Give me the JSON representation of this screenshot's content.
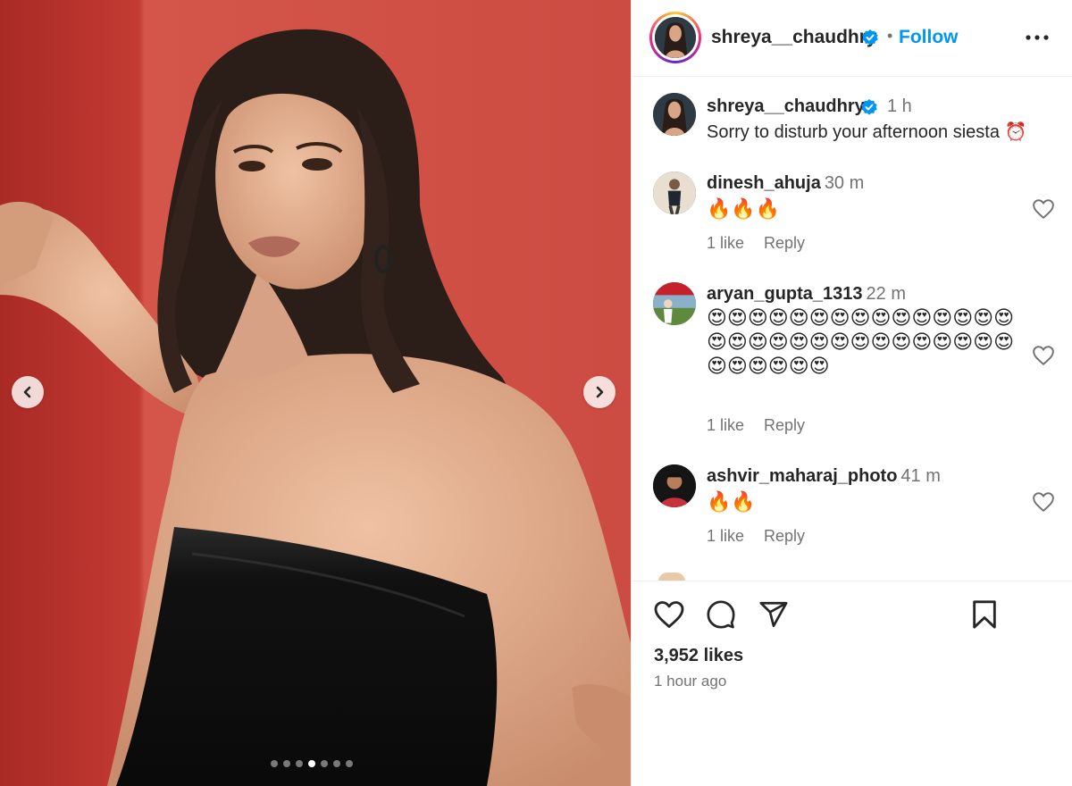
{
  "post": {
    "media": {
      "slide_count": 7,
      "active_slide": 4,
      "prev_icon": "chevron-left-icon",
      "next_icon": "chevron-right-icon"
    },
    "author": {
      "username": "shreya__chaudhry",
      "separator": "•",
      "follow_label": "Follow",
      "more_icon": "more-horizontal-icon"
    },
    "caption": {
      "username": "shreya__chaudhry",
      "time": "1 h",
      "text": "Sorry to disturb your afternoon siesta ⏰"
    },
    "comments": [
      {
        "username": "dinesh_ahuja",
        "time": "30 m",
        "text": "🔥🔥🔥",
        "likes": "1 like",
        "reply_label": "Reply"
      },
      {
        "username": "aryan_gupta_1313",
        "time": "22 m",
        "text": "😍😍😍😍😍😍😍😍😍😍😍😍😍😍😍😍😍😍😍😍😍😍😍😍😍😍😍😍😍😍😍😍😍😍😍😍",
        "likes": "1 like",
        "reply_label": "Reply"
      },
      {
        "username": "ashvir_maharaj_photo",
        "time": "41 m",
        "text": "🔥🔥",
        "likes": "1 like",
        "reply_label": "Reply"
      }
    ],
    "likes": "3,952 likes",
    "posted_ago": "1 hour ago"
  },
  "colors": {
    "link_blue": "#0095f6",
    "verified_blue": "#0095f6",
    "muted_text": "#737373",
    "background_red": "#cf4a40"
  }
}
